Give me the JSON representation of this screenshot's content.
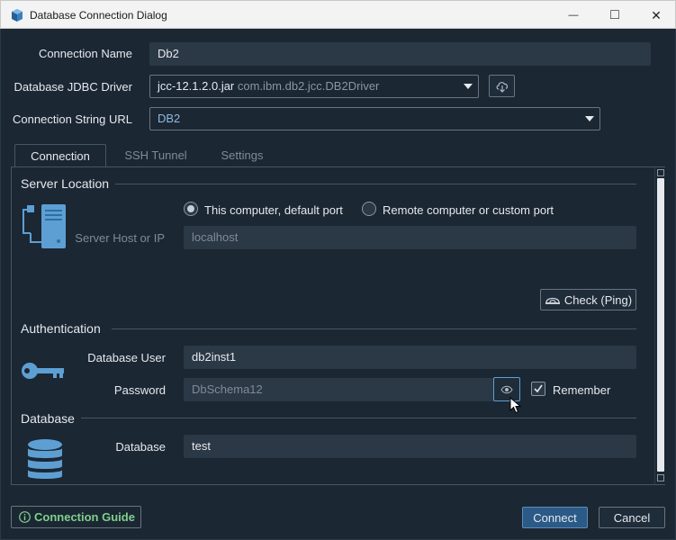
{
  "window": {
    "title": "Database Connection Dialog",
    "controls": {
      "minimize": "—",
      "maximize": "□",
      "close": "✕"
    }
  },
  "form": {
    "connection_name_label": "Connection Name",
    "connection_name_value": "Db2",
    "driver_label": "Database JDBC Driver",
    "driver_jar": "jcc-12.1.2.0.jar",
    "driver_class": "com.ibm.db2.jcc.DB2Driver",
    "url_label": "Connection String URL",
    "url_value": "DB2"
  },
  "tabs": [
    {
      "label": "Connection",
      "active": true
    },
    {
      "label": "SSH Tunnel",
      "active": false
    },
    {
      "label": "Settings",
      "active": false
    }
  ],
  "server_location": {
    "title": "Server Location",
    "radio_default": "This computer, default port",
    "radio_remote": "Remote computer or custom port",
    "selected": "default",
    "host_label": "Server Host or IP",
    "host_value": "localhost",
    "check_button": "Check (Ping)"
  },
  "authentication": {
    "title": "Authentication",
    "user_label": "Database User",
    "user_value": "db2inst1",
    "password_label": "Password",
    "password_value": "DbSchema12",
    "remember_label": "Remember",
    "remember_checked": true
  },
  "database": {
    "title": "Database",
    "db_label": "Database",
    "db_value": "test"
  },
  "footer": {
    "guide_label": "Connection Guide",
    "connect_label": "Connect",
    "cancel_label": "Cancel"
  },
  "colors": {
    "background": "#1b2733",
    "input": "#2b3846",
    "icon_blue": "#5e9fd3",
    "guide_green": "#7fd08c",
    "primary_button": "#2b5a86"
  }
}
